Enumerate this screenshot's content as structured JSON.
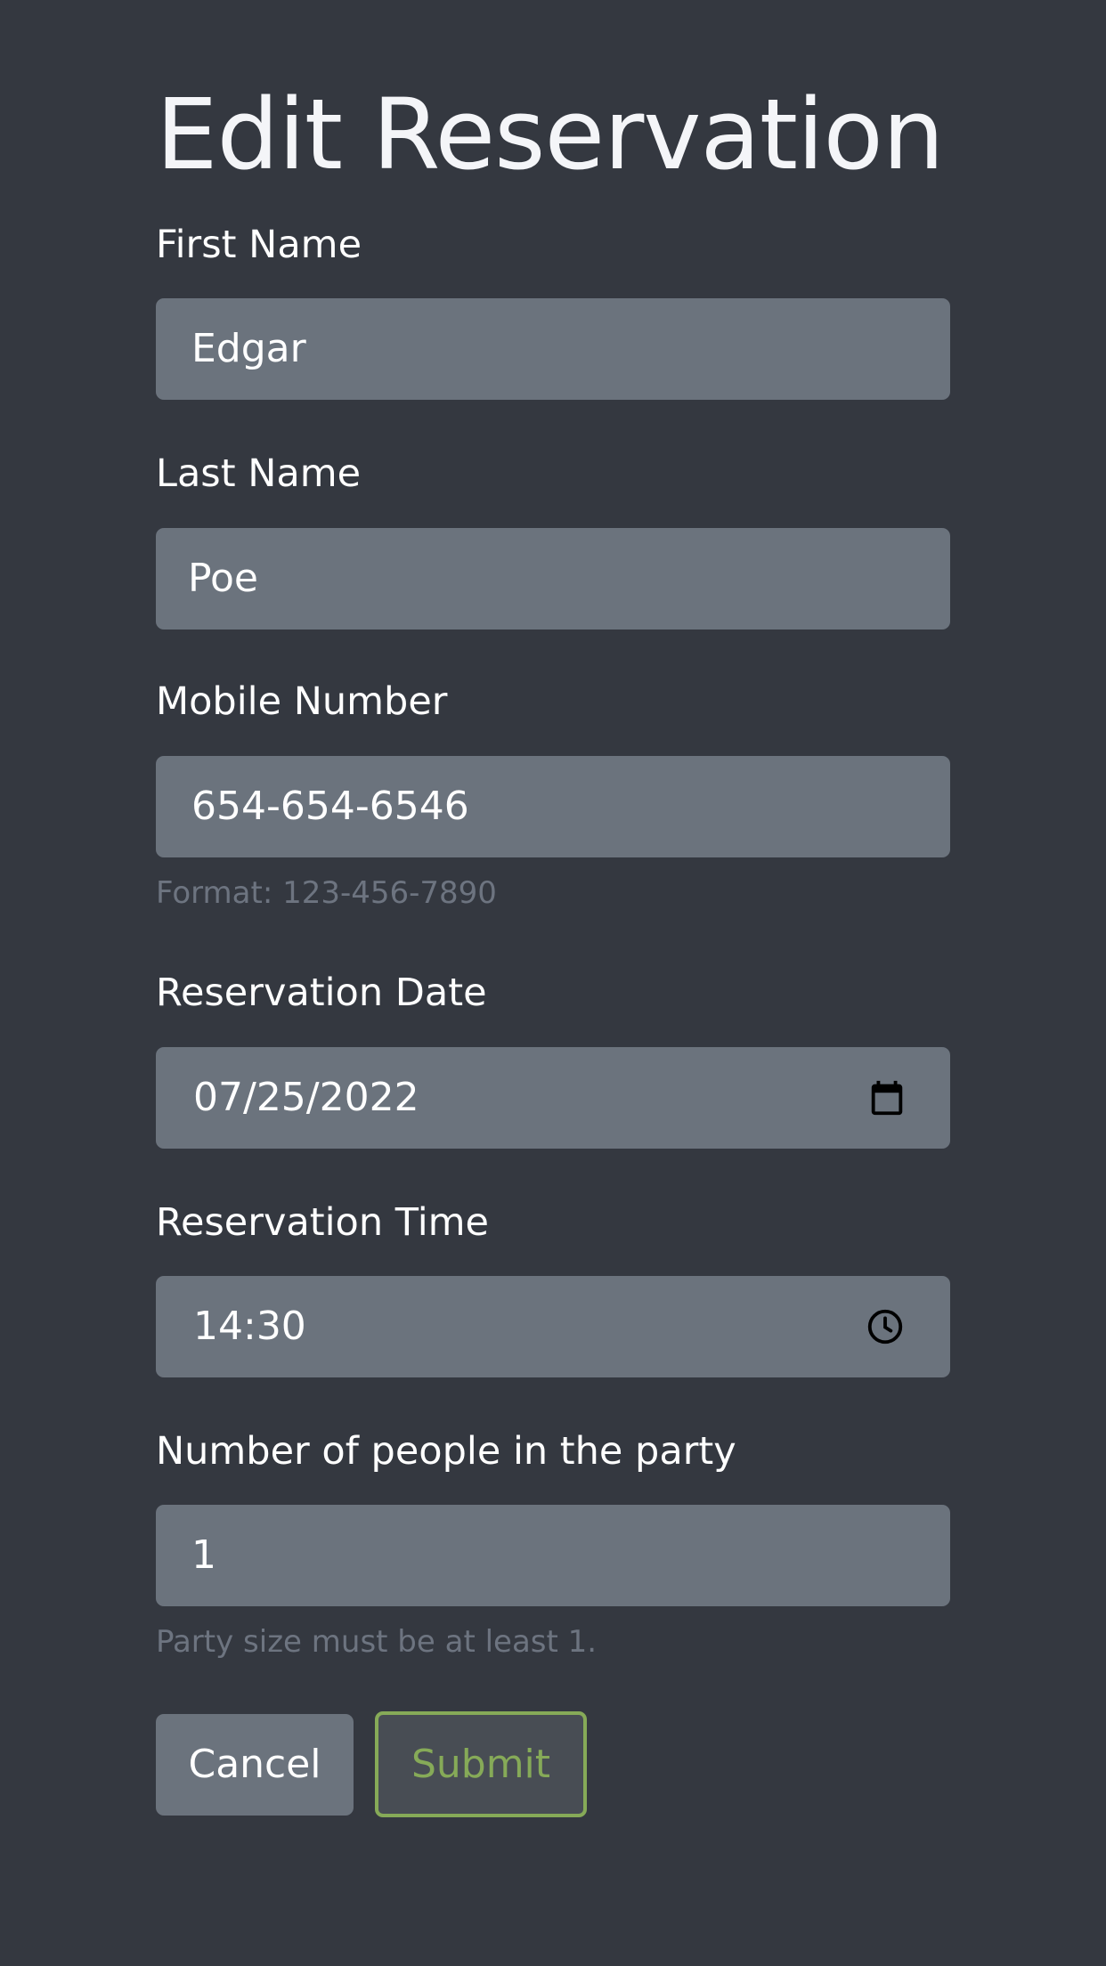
{
  "page": {
    "title": "Edit Reservation"
  },
  "form": {
    "first_name": {
      "label": "First Name",
      "value": "Edgar"
    },
    "last_name": {
      "label": "Last Name",
      "value": "Poe"
    },
    "mobile_number": {
      "label": "Mobile Number",
      "value": "654-654-6546",
      "help": "Format: 123-456-7890"
    },
    "reservation_date": {
      "label": "Reservation Date",
      "value": "07/25/2022",
      "icon": "calendar-icon"
    },
    "reservation_time": {
      "label": "Reservation Time",
      "value": "14:30",
      "icon": "clock-icon"
    },
    "people": {
      "label": "Number of people in the party",
      "value": "1",
      "help": "Party size must be at least 1."
    }
  },
  "actions": {
    "cancel_label": "Cancel",
    "submit_label": "Submit"
  },
  "colors": {
    "background": "#343840",
    "field_background": "#6b737d",
    "submit_accent": "#86aa58",
    "help_text": "#6d7480"
  }
}
